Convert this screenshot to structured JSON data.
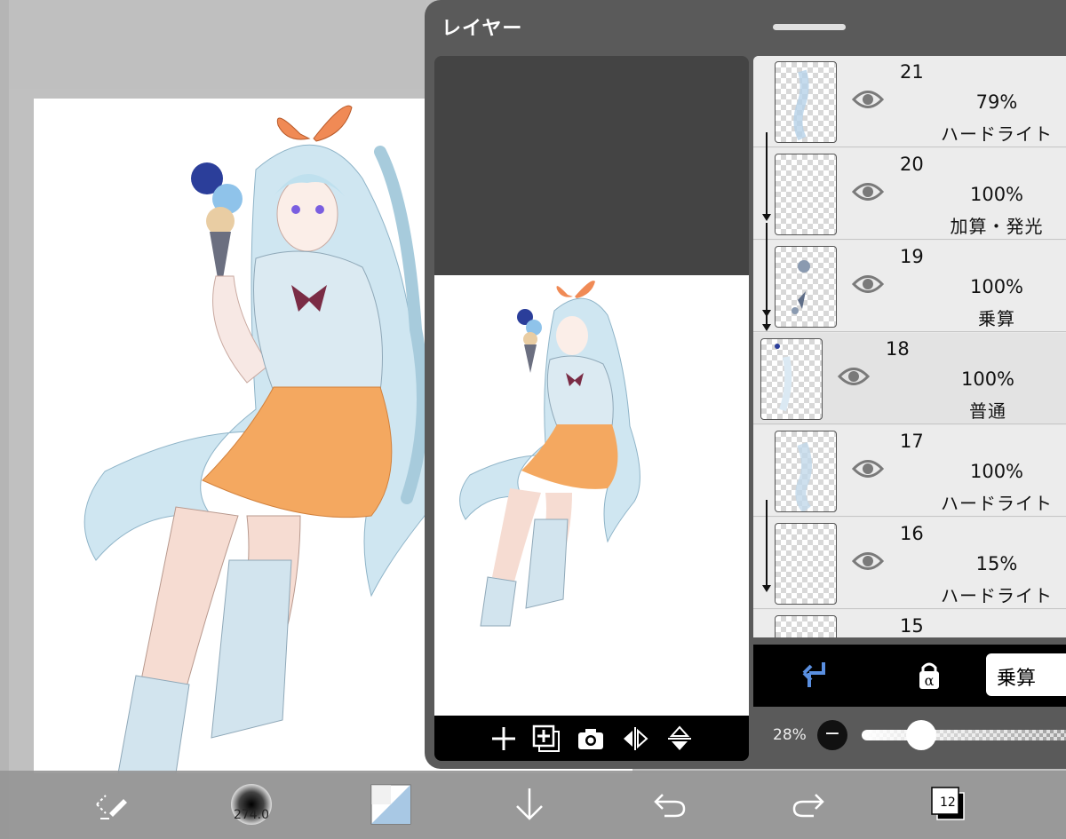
{
  "panel": {
    "title": "レイヤー"
  },
  "layers": [
    {
      "number": "21",
      "opacity": "79%",
      "blend": "ハードライト"
    },
    {
      "number": "20",
      "opacity": "100%",
      "blend": "加算・発光"
    },
    {
      "number": "19",
      "opacity": "100%",
      "blend": "乗算"
    },
    {
      "number": "18",
      "opacity": "100%",
      "blend": "普通"
    },
    {
      "number": "17",
      "opacity": "100%",
      "blend": "ハードライト"
    },
    {
      "number": "16",
      "opacity": "15%",
      "blend": "ハードライト"
    },
    {
      "number": "15",
      "opacity": "",
      "blend": ""
    }
  ],
  "controls": {
    "blend_mode": "乗算",
    "opacity": "28%",
    "opacity_fraction": 0.28,
    "minus_symbol": "−"
  },
  "toolbar": {
    "brush_size": "274.0",
    "layers_count": "12"
  },
  "preview_toolbar": {
    "icons": [
      "add-layer-icon",
      "duplicate-layer-icon",
      "camera-icon",
      "flip-horizontal-icon",
      "flip-vertical-icon"
    ]
  },
  "bottom_toolbar": {
    "icons": [
      "transform-tool-icon",
      "brush-size-icon",
      "color-swatch-icon",
      "download-icon",
      "undo-icon",
      "redo-icon",
      "layers-icon"
    ]
  },
  "colors": {
    "panel_bg": "#5a5a5a",
    "accent": "#5a8fe0",
    "ribbon": "#f08a55",
    "hair": "#b8dcea",
    "skirt": "#f4a860"
  }
}
